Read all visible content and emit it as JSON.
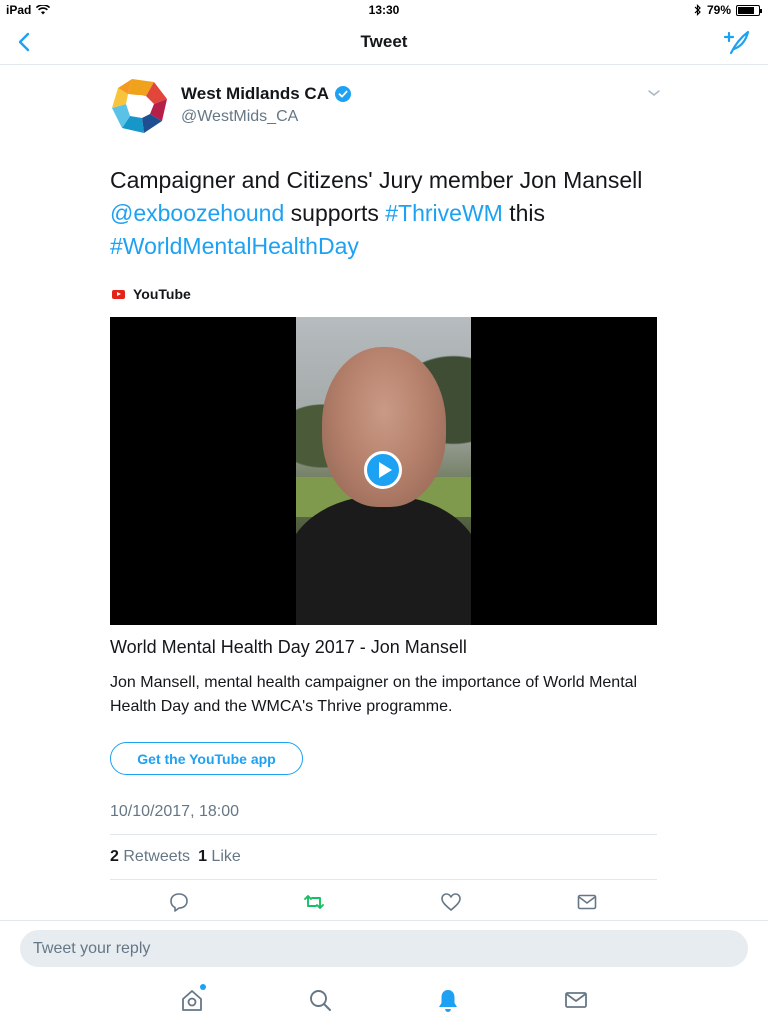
{
  "status_bar": {
    "device": "iPad",
    "time": "13:30",
    "battery_percent": "79%",
    "battery_level": 0.79
  },
  "nav": {
    "title": "Tweet",
    "back_icon": "chevron-left-icon",
    "compose_icon": "compose-tweet-icon"
  },
  "tweet": {
    "author_name": "West Midlands CA",
    "author_handle": "@WestMids_CA",
    "verified": true,
    "text_part1": "Campaigner and Citizens' Jury member Jon Mansell ",
    "mention": "@exboozehound",
    "text_part2": " supports ",
    "hashtag1": "#ThriveWM",
    "text_part3": " this ",
    "hashtag2": "#WorldMentalHealthDay",
    "timestamp": "10/10/2017, 18:00",
    "retweets_count": "2",
    "retweets_label": "Retweets",
    "likes_count": "1",
    "likes_label": "Like"
  },
  "card": {
    "source": "YouTube",
    "title": "World Mental Health Day 2017 - Jon Mansell",
    "description": "Jon Mansell, mental health campaigner on the importance of World Mental Health Day and the WMCA's Thrive programme.",
    "cta": "Get the YouTube app"
  },
  "reply": {
    "placeholder": "Tweet your reply"
  },
  "colors": {
    "accent": "#1da1f2",
    "retweet_green": "#17bf63",
    "muted": "#657786",
    "youtube_red": "#e62117"
  }
}
